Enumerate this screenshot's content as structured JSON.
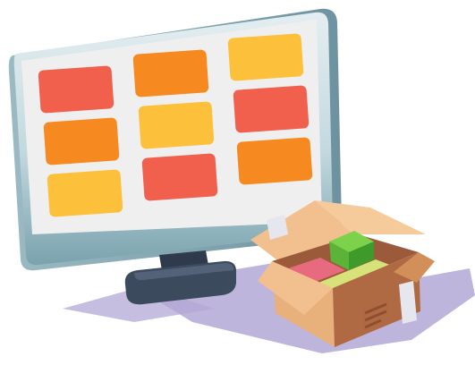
{
  "illustration": {
    "subject": "monitor-with-app-grid-and-open-box",
    "monitor": {
      "tiles": [
        {
          "color": "#F0604C"
        },
        {
          "color": "#F6891F"
        },
        {
          "color": "#FDC03A"
        },
        {
          "color": "#F6891F"
        },
        {
          "color": "#FDC03A"
        },
        {
          "color": "#F0604C"
        },
        {
          "color": "#FDC03A"
        },
        {
          "color": "#F0604C"
        },
        {
          "color": "#F6891F"
        }
      ],
      "screen_color": "#EFEFEF",
      "bezel_top_color": "#D7E6EB",
      "bezel_bottom_color": "#7FA5B0",
      "stand_color": "#3C4A5E"
    },
    "box": {
      "cardboard_color": "#E8B07A",
      "cardboard_dark_color": "#B06A43",
      "contents": [
        "green-cube",
        "pink-block",
        "yellow-green-block"
      ]
    },
    "shadow_color": "#B3A8D6"
  }
}
